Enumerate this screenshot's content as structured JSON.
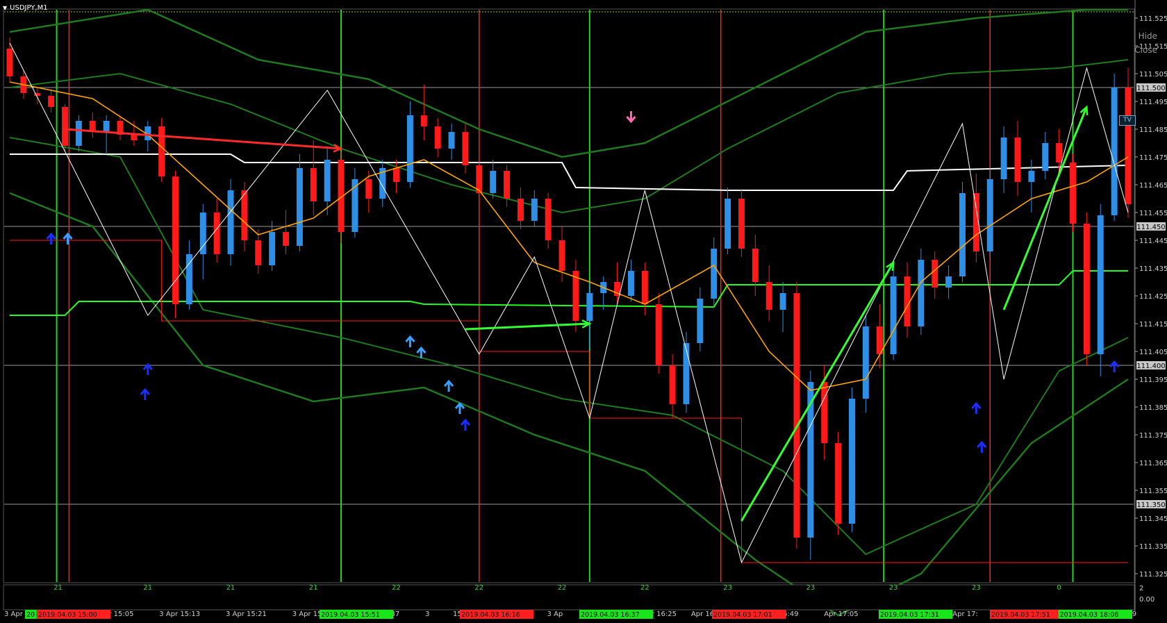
{
  "window": {
    "title": "USDJPY,M1",
    "menu_icon": "triangle-down-icon"
  },
  "controls": {
    "hide_label": "Hide",
    "close_label": "Close",
    "tv_label": "TV"
  },
  "colors": {
    "background": "#000000",
    "bull_candle": "#2e8fe6",
    "bear_candle": "#ff1a1a",
    "bands": "#1f7a1f",
    "bright_green": "#22ff22",
    "orange_ma": "#ffa500",
    "white_line": "#ffffff",
    "zigzag": "#ffffff",
    "red_marker": "#ff2020",
    "green_marker": "#21d321"
  },
  "price_axis": {
    "labels": [
      "111.525",
      "111.515",
      "111.505",
      "111.495",
      "111.485",
      "111.475",
      "111.465",
      "111.455",
      "111.445",
      "111.435",
      "111.425",
      "111.415",
      "111.405",
      "111.395",
      "111.385",
      "111.375",
      "111.365",
      "111.355",
      "111.345",
      "111.335",
      "111.325"
    ],
    "highlighted": [
      "111.500",
      "111.450",
      "111.400",
      "111.350"
    ]
  },
  "indicator_axis": {
    "labels": [
      "2",
      "0.00"
    ]
  },
  "sub_axis_labels": [
    "21",
    "21",
    "21",
    "21",
    "22",
    "22",
    "22",
    "22",
    "23",
    "23",
    "23",
    "23",
    "0"
  ],
  "time_axis": {
    "labels": [
      "3 Apr 2",
      "3 Apr 15:05",
      "3 Apr 15:13",
      "3 Apr 15:21",
      "3 Apr 15:29",
      "3 Apr 15:37",
      "3",
      "15:53",
      "3 Apr 16:01",
      "3 Ap",
      "5:17",
      "3 Apr 16:25",
      "Apr 16:41",
      "3 Apr 16:49",
      "Apr 17:05",
      "3 Apr 17:13",
      "3 Apr 17:",
      "3 Apr 17:37",
      "17:53",
      "r 18:09"
    ],
    "badges": [
      {
        "text": "20",
        "color": "green"
      },
      {
        "text": "2019.04.03 15:00",
        "color": "red"
      },
      {
        "text": "2019.04.03 15:51",
        "color": "green"
      },
      {
        "text": "2019.04.03 16:16",
        "color": "red"
      },
      {
        "text": "2019.04.03 16:37",
        "color": "green"
      },
      {
        "text": "2019.04.03 17:01",
        "color": "red"
      },
      {
        "text": "2019.04.03 17:31",
        "color": "green"
      },
      {
        "text": "2019.04.03 17:51",
        "color": "red"
      },
      {
        "text": "2019.04.03 18:06",
        "color": "green"
      }
    ]
  },
  "chart_data": {
    "type": "candlestick",
    "symbol": "USDJPY",
    "timeframe": "M1",
    "ylim": [
      111.322,
      111.528
    ],
    "x_range": [
      0,
      81
    ],
    "candles": [
      {
        "o": 111.514,
        "h": 111.518,
        "l": 111.502,
        "c": 111.504
      },
      {
        "o": 111.504,
        "h": 111.506,
        "l": 111.496,
        "c": 111.498
      },
      {
        "o": 111.498,
        "h": 111.5,
        "l": 111.494,
        "c": 111.497
      },
      {
        "o": 111.497,
        "h": 111.499,
        "l": 111.491,
        "c": 111.493
      },
      {
        "o": 111.493,
        "h": 111.494,
        "l": 111.477,
        "c": 111.479
      },
      {
        "o": 111.479,
        "h": 111.49,
        "l": 111.477,
        "c": 111.488
      },
      {
        "o": 111.488,
        "h": 111.491,
        "l": 111.482,
        "c": 111.484
      },
      {
        "o": 111.484,
        "h": 111.49,
        "l": 111.476,
        "c": 111.488
      },
      {
        "o": 111.488,
        "h": 111.49,
        "l": 111.481,
        "c": 111.483
      },
      {
        "o": 111.483,
        "h": 111.488,
        "l": 111.479,
        "c": 111.481
      },
      {
        "o": 111.481,
        "h": 111.488,
        "l": 111.477,
        "c": 111.486
      },
      {
        "o": 111.486,
        "h": 111.489,
        "l": 111.466,
        "c": 111.468
      },
      {
        "o": 111.468,
        "h": 111.47,
        "l": 111.417,
        "c": 111.422
      },
      {
        "o": 111.422,
        "h": 111.445,
        "l": 111.42,
        "c": 111.44
      },
      {
        "o": 111.44,
        "h": 111.458,
        "l": 111.431,
        "c": 111.455
      },
      {
        "o": 111.455,
        "h": 111.46,
        "l": 111.437,
        "c": 111.44
      },
      {
        "o": 111.44,
        "h": 111.467,
        "l": 111.436,
        "c": 111.463
      },
      {
        "o": 111.463,
        "h": 111.466,
        "l": 111.441,
        "c": 111.445
      },
      {
        "o": 111.445,
        "h": 111.449,
        "l": 111.433,
        "c": 111.436
      },
      {
        "o": 111.436,
        "h": 111.452,
        "l": 111.434,
        "c": 111.448
      },
      {
        "o": 111.448,
        "h": 111.456,
        "l": 111.44,
        "c": 111.443
      },
      {
        "o": 111.443,
        "h": 111.476,
        "l": 111.441,
        "c": 111.471
      },
      {
        "o": 111.471,
        "h": 111.481,
        "l": 111.454,
        "c": 111.459
      },
      {
        "o": 111.459,
        "h": 111.478,
        "l": 111.454,
        "c": 111.474
      },
      {
        "o": 111.474,
        "h": 111.477,
        "l": 111.444,
        "c": 111.448
      },
      {
        "o": 111.448,
        "h": 111.471,
        "l": 111.446,
        "c": 111.467
      },
      {
        "o": 111.467,
        "h": 111.47,
        "l": 111.455,
        "c": 111.46
      },
      {
        "o": 111.46,
        "h": 111.474,
        "l": 111.457,
        "c": 111.471
      },
      {
        "o": 111.471,
        "h": 111.474,
        "l": 111.462,
        "c": 111.466
      },
      {
        "o": 111.466,
        "h": 111.495,
        "l": 111.464,
        "c": 111.49
      },
      {
        "o": 111.49,
        "h": 111.501,
        "l": 111.481,
        "c": 111.486
      },
      {
        "o": 111.486,
        "h": 111.489,
        "l": 111.475,
        "c": 111.478
      },
      {
        "o": 111.478,
        "h": 111.487,
        "l": 111.474,
        "c": 111.484
      },
      {
        "o": 111.484,
        "h": 111.487,
        "l": 111.469,
        "c": 111.472
      },
      {
        "o": 111.472,
        "h": 111.477,
        "l": 111.459,
        "c": 111.462
      },
      {
        "o": 111.462,
        "h": 111.474,
        "l": 111.46,
        "c": 111.47
      },
      {
        "o": 111.47,
        "h": 111.472,
        "l": 111.457,
        "c": 111.46
      },
      {
        "o": 111.46,
        "h": 111.464,
        "l": 111.449,
        "c": 111.452
      },
      {
        "o": 111.452,
        "h": 111.463,
        "l": 111.45,
        "c": 111.46
      },
      {
        "o": 111.46,
        "h": 111.462,
        "l": 111.442,
        "c": 111.445
      },
      {
        "o": 111.445,
        "h": 111.45,
        "l": 111.43,
        "c": 111.434
      },
      {
        "o": 111.434,
        "h": 111.438,
        "l": 111.412,
        "c": 111.416
      },
      {
        "o": 111.416,
        "h": 111.43,
        "l": 111.406,
        "c": 111.426
      },
      {
        "o": 111.426,
        "h": 111.432,
        "l": 111.42,
        "c": 111.43
      },
      {
        "o": 111.43,
        "h": 111.437,
        "l": 111.422,
        "c": 111.425
      },
      {
        "o": 111.425,
        "h": 111.438,
        "l": 111.423,
        "c": 111.434
      },
      {
        "o": 111.434,
        "h": 111.437,
        "l": 111.418,
        "c": 111.422
      },
      {
        "o": 111.422,
        "h": 111.426,
        "l": 111.397,
        "c": 111.4
      },
      {
        "o": 111.4,
        "h": 111.404,
        "l": 111.381,
        "c": 111.386
      },
      {
        "o": 111.386,
        "h": 111.412,
        "l": 111.383,
        "c": 111.408
      },
      {
        "o": 111.408,
        "h": 111.428,
        "l": 111.405,
        "c": 111.424
      },
      {
        "o": 111.424,
        "h": 111.446,
        "l": 111.421,
        "c": 111.442
      },
      {
        "o": 111.442,
        "h": 111.464,
        "l": 111.44,
        "c": 111.46
      },
      {
        "o": 111.46,
        "h": 111.463,
        "l": 111.439,
        "c": 111.442
      },
      {
        "o": 111.442,
        "h": 111.447,
        "l": 111.425,
        "c": 111.43
      },
      {
        "o": 111.43,
        "h": 111.436,
        "l": 111.416,
        "c": 111.42
      },
      {
        "o": 111.42,
        "h": 111.43,
        "l": 111.412,
        "c": 111.426
      },
      {
        "o": 111.426,
        "h": 111.43,
        "l": 111.334,
        "c": 111.338
      },
      {
        "o": 111.338,
        "h": 111.398,
        "l": 111.33,
        "c": 111.394
      },
      {
        "o": 111.394,
        "h": 111.4,
        "l": 111.366,
        "c": 111.372
      },
      {
        "o": 111.372,
        "h": 111.376,
        "l": 111.339,
        "c": 111.343
      },
      {
        "o": 111.343,
        "h": 111.392,
        "l": 111.34,
        "c": 111.388
      },
      {
        "o": 111.388,
        "h": 111.418,
        "l": 111.383,
        "c": 111.414
      },
      {
        "o": 111.414,
        "h": 111.422,
        "l": 111.399,
        "c": 111.404
      },
      {
        "o": 111.404,
        "h": 111.436,
        "l": 111.402,
        "c": 111.432
      },
      {
        "o": 111.432,
        "h": 111.437,
        "l": 111.41,
        "c": 111.414
      },
      {
        "o": 111.414,
        "h": 111.442,
        "l": 111.411,
        "c": 111.438
      },
      {
        "o": 111.438,
        "h": 111.441,
        "l": 111.424,
        "c": 111.428
      },
      {
        "o": 111.428,
        "h": 111.436,
        "l": 111.424,
        "c": 111.432
      },
      {
        "o": 111.432,
        "h": 111.466,
        "l": 111.43,
        "c": 111.462
      },
      {
        "o": 111.462,
        "h": 111.469,
        "l": 111.437,
        "c": 111.441
      },
      {
        "o": 111.441,
        "h": 111.471,
        "l": 111.439,
        "c": 111.467
      },
      {
        "o": 111.467,
        "h": 111.486,
        "l": 111.462,
        "c": 111.482
      },
      {
        "o": 111.482,
        "h": 111.488,
        "l": 111.461,
        "c": 111.466
      },
      {
        "o": 111.466,
        "h": 111.474,
        "l": 111.455,
        "c": 111.47
      },
      {
        "o": 111.47,
        "h": 111.484,
        "l": 111.467,
        "c": 111.48
      },
      {
        "o": 111.48,
        "h": 111.485,
        "l": 111.468,
        "c": 111.473
      },
      {
        "o": 111.473,
        "h": 111.476,
        "l": 111.448,
        "c": 111.451
      },
      {
        "o": 111.451,
        "h": 111.455,
        "l": 111.4,
        "c": 111.404
      },
      {
        "o": 111.404,
        "h": 111.458,
        "l": 111.396,
        "c": 111.454
      },
      {
        "o": 111.454,
        "h": 111.505,
        "l": 111.452,
        "c": 111.5
      },
      {
        "o": 111.5,
        "h": 111.507,
        "l": 111.453,
        "c": 111.458
      }
    ],
    "zigzag": [
      [
        0,
        111.516
      ],
      [
        4,
        111.477
      ],
      [
        10,
        111.418
      ],
      [
        23,
        111.499
      ],
      [
        34,
        111.404
      ],
      [
        38,
        111.439
      ],
      [
        42,
        111.381
      ],
      [
        46,
        111.463
      ],
      [
        53,
        111.329
      ],
      [
        69,
        111.487
      ],
      [
        72,
        111.395
      ],
      [
        78,
        111.507
      ],
      [
        81,
        111.455
      ]
    ],
    "orange_ma": [
      [
        0,
        111.502
      ],
      [
        6,
        111.496
      ],
      [
        10,
        111.483
      ],
      [
        14,
        111.465
      ],
      [
        18,
        111.447
      ],
      [
        22,
        111.453
      ],
      [
        26,
        111.468
      ],
      [
        30,
        111.474
      ],
      [
        34,
        111.463
      ],
      [
        38,
        111.437
      ],
      [
        42,
        111.43
      ],
      [
        46,
        111.422
      ],
      [
        51,
        111.436
      ],
      [
        55,
        111.405
      ],
      [
        58,
        111.391
      ],
      [
        62,
        111.395
      ],
      [
        66,
        111.43
      ],
      [
        70,
        111.447
      ],
      [
        74,
        111.46
      ],
      [
        78,
        111.466
      ],
      [
        81,
        111.475
      ]
    ],
    "white_level": [
      [
        0,
        111.476
      ],
      [
        16,
        111.476
      ],
      [
        17,
        111.473
      ],
      [
        40,
        111.473
      ],
      [
        41,
        111.464
      ],
      [
        52,
        111.463
      ],
      [
        64,
        111.463
      ],
      [
        65,
        111.47
      ],
      [
        81,
        111.472
      ]
    ],
    "green_level": [
      [
        0,
        111.418
      ],
      [
        4,
        111.418
      ],
      [
        5,
        111.423
      ],
      [
        29,
        111.423
      ],
      [
        30,
        111.422
      ],
      [
        51,
        111.421
      ],
      [
        52,
        111.429
      ],
      [
        76,
        111.429
      ],
      [
        77,
        111.434
      ],
      [
        81,
        111.434
      ]
    ],
    "red_level": [
      [
        0,
        111.445
      ],
      [
        11,
        111.445
      ],
      [
        11,
        111.416
      ],
      [
        34,
        111.416
      ],
      [
        34,
        111.405
      ],
      [
        42,
        111.405
      ],
      [
        42,
        111.381
      ],
      [
        53,
        111.381
      ],
      [
        53,
        111.329
      ],
      [
        81,
        111.329
      ]
    ],
    "bands_upper": [
      [
        0,
        111.52
      ],
      [
        10,
        111.528
      ],
      [
        18,
        111.51
      ],
      [
        26,
        111.503
      ],
      [
        34,
        111.485
      ],
      [
        40,
        111.475
      ],
      [
        46,
        111.48
      ],
      [
        54,
        111.5
      ],
      [
        62,
        111.52
      ],
      [
        70,
        111.525
      ],
      [
        78,
        111.528
      ],
      [
        81,
        111.528
      ]
    ],
    "bands_upper2": [
      [
        0,
        111.5
      ],
      [
        8,
        111.505
      ],
      [
        16,
        111.494
      ],
      [
        24,
        111.478
      ],
      [
        32,
        111.465
      ],
      [
        40,
        111.455
      ],
      [
        46,
        111.46
      ],
      [
        52,
        111.478
      ],
      [
        60,
        111.498
      ],
      [
        68,
        111.505
      ],
      [
        76,
        111.507
      ],
      [
        81,
        111.51
      ]
    ],
    "bands_lower": [
      [
        0,
        111.462
      ],
      [
        6,
        111.45
      ],
      [
        14,
        111.4
      ],
      [
        22,
        111.387
      ],
      [
        30,
        111.392
      ],
      [
        38,
        111.375
      ],
      [
        46,
        111.362
      ],
      [
        54,
        111.33
      ],
      [
        60,
        111.31
      ],
      [
        66,
        111.325
      ],
      [
        74,
        111.372
      ],
      [
        81,
        111.395
      ]
    ],
    "bands_lower2": [
      [
        0,
        111.482
      ],
      [
        8,
        111.475
      ],
      [
        14,
        111.42
      ],
      [
        24,
        111.41
      ],
      [
        32,
        111.4
      ],
      [
        40,
        111.388
      ],
      [
        48,
        111.382
      ],
      [
        56,
        111.362
      ],
      [
        62,
        111.332
      ],
      [
        70,
        111.35
      ],
      [
        76,
        111.398
      ],
      [
        81,
        111.41
      ]
    ],
    "arrows_trend": [
      {
        "from": [
          4,
          111.485
        ],
        "to": [
          24,
          111.478
        ],
        "color": "red"
      },
      {
        "from": [
          33,
          111.413
        ],
        "to": [
          42,
          111.415
        ],
        "color": "green"
      },
      {
        "from": [
          53,
          111.344
        ],
        "to": [
          64,
          111.437
        ],
        "color": "green"
      },
      {
        "from": [
          72,
          111.42
        ],
        "to": [
          78,
          111.493
        ],
        "color": "green"
      }
    ],
    "buy_arrows": [
      {
        "x": 3,
        "y": 111.445,
        "tone": "blue"
      },
      {
        "x": 4.2,
        "y": 111.445,
        "tone": "light"
      },
      {
        "x": 10,
        "y": 111.398,
        "tone": "blue"
      },
      {
        "x": 9.8,
        "y": 111.389,
        "tone": "blue"
      },
      {
        "x": 29,
        "y": 111.408,
        "tone": "light"
      },
      {
        "x": 29.8,
        "y": 111.404,
        "tone": "light"
      },
      {
        "x": 31.8,
        "y": 111.392,
        "tone": "light"
      },
      {
        "x": 32.6,
        "y": 111.384,
        "tone": "light"
      },
      {
        "x": 33,
        "y": 111.378,
        "tone": "blue"
      },
      {
        "x": 70,
        "y": 111.384,
        "tone": "blue"
      },
      {
        "x": 70.4,
        "y": 111.37,
        "tone": "blue"
      },
      {
        "x": 80,
        "y": 111.399,
        "tone": "blue"
      }
    ],
    "sell_arrows": [
      {
        "x": 45,
        "y": 111.49,
        "tone": "pink"
      }
    ],
    "green_verticals": [
      3.4,
      24,
      42,
      63.3,
      77
    ],
    "red_verticals": [
      4.3,
      34,
      51.5,
      71
    ],
    "horizontal_marks": [
      111.5,
      111.45,
      111.4,
      111.35
    ]
  }
}
